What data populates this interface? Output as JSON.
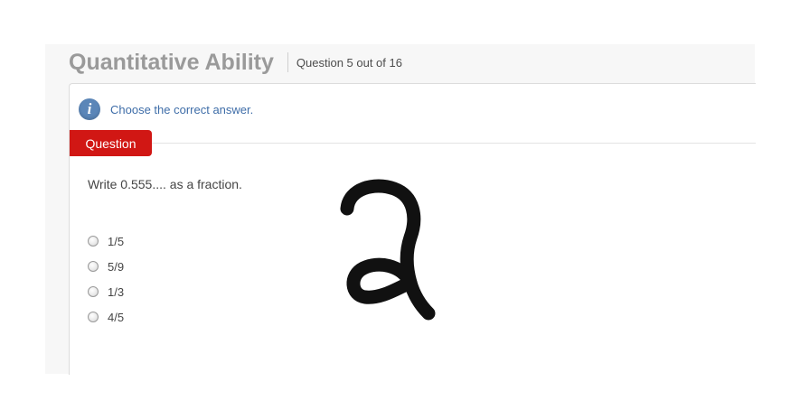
{
  "header": {
    "section_title": "Quantitative Ability",
    "question_counter": "Question 5 out of 16"
  },
  "instruction": {
    "icon": "info-icon",
    "text": "Choose the correct answer."
  },
  "question": {
    "tab_label": "Question",
    "prompt": "Write 0.555.... as a fraction.",
    "options": [
      {
        "label": "1/5",
        "selected": false
      },
      {
        "label": "5/9",
        "selected": false
      },
      {
        "label": "1/3",
        "selected": false
      },
      {
        "label": "4/5",
        "selected": false
      }
    ]
  },
  "overlay": {
    "handwritten_glyph": "2"
  },
  "colors": {
    "title_gray": "#9a9a9a",
    "accent_red": "#d11714",
    "info_blue": "#3e6da8",
    "panel_bg": "#f7f7f7"
  }
}
